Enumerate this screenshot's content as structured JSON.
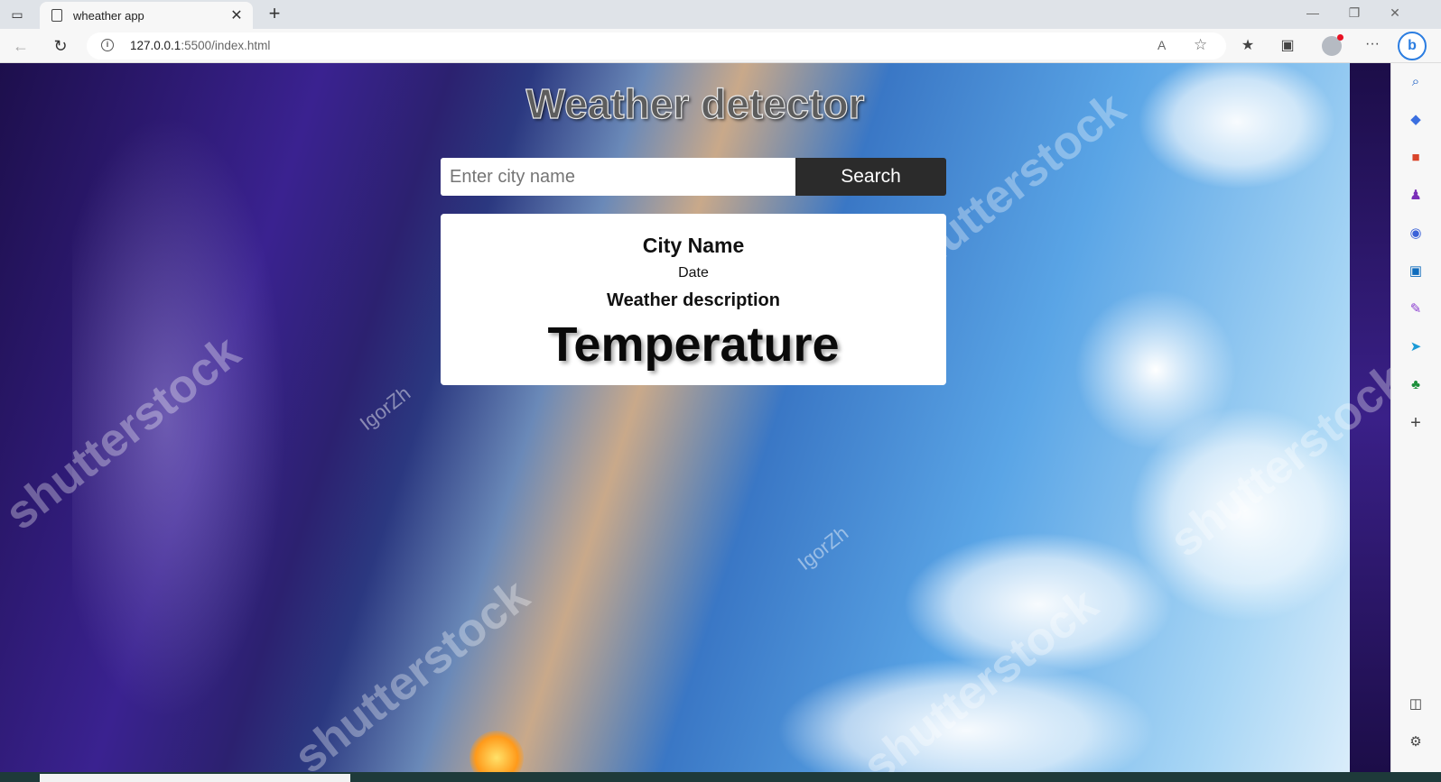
{
  "browser": {
    "tab_title": "wheather app",
    "tab_close": "✕",
    "new_tab": "+",
    "url_host": "127.0.0.1",
    "url_path": ":5500/index.html",
    "window_controls": {
      "minimize": "—",
      "restore": "❐",
      "close": "✕"
    },
    "toolbar": {
      "read_aloud": "A",
      "add_favorite": "☆",
      "favorites": "★",
      "collections": "▣",
      "more": "···"
    },
    "bing_label": "b"
  },
  "page": {
    "title": "Weather detector",
    "search": {
      "placeholder": "Enter city name",
      "value": "",
      "button_label": "Search"
    },
    "card": {
      "city": "City Name",
      "date": "Date",
      "description": "Weather description",
      "temperature": "Temperature"
    }
  },
  "sidebar": {
    "items": [
      "search-icon",
      "tag-icon",
      "briefcase-icon",
      "games-icon",
      "copilot-icon",
      "outlook-icon",
      "designer-icon",
      "send-icon",
      "tree-icon",
      "add-icon",
      "split-icon",
      "settings-icon"
    ]
  }
}
